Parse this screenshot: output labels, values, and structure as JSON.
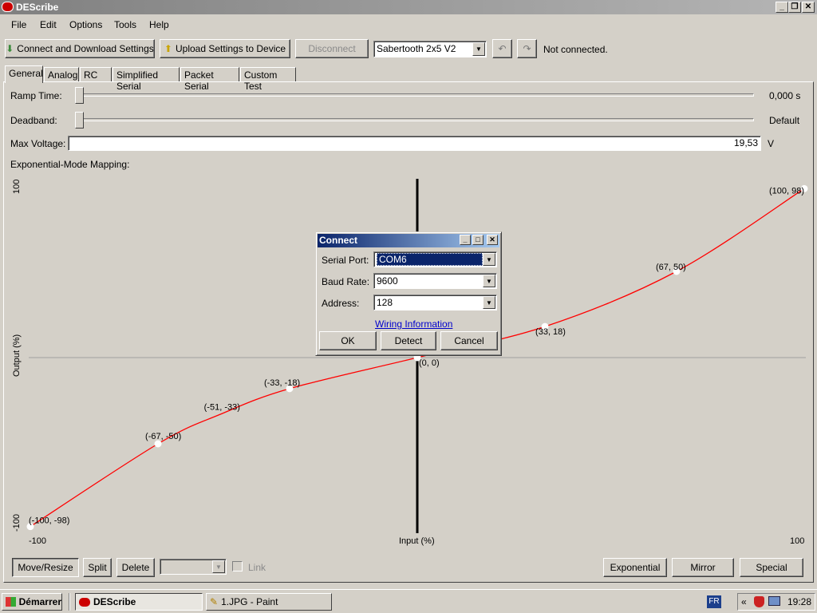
{
  "window": {
    "title": "DEScribe"
  },
  "menu": [
    "File",
    "Edit",
    "Options",
    "Tools",
    "Help"
  ],
  "toolbar": {
    "connect_label": "Connect and Download Settings",
    "upload_label": "Upload Settings to Device",
    "disconnect_label": "Disconnect",
    "device_select": "Sabertooth 2x5 V2",
    "status": "Not connected."
  },
  "tabs": [
    "General",
    "Analog",
    "RC",
    "Simplified Serial",
    "Packet Serial",
    "Custom Test"
  ],
  "active_tab": "General",
  "general": {
    "ramp_label": "Ramp Time:",
    "ramp_value": "0,000 s",
    "ramp_level": 0,
    "deadband_label": "Deadband:",
    "deadband_value": "Default",
    "deadband_level": 0,
    "maxv_label": "Max Voltage:",
    "maxv_value": "19,53",
    "maxv_unit": "V",
    "mapping_label": "Exponential-Mode Mapping:"
  },
  "chart_data": {
    "type": "line",
    "ylabel": "Output (%)",
    "xlabel": "Input (%)",
    "x_tick_min": "-100",
    "x_tick_max": "100",
    "y_tick_min": "-100",
    "y_tick_max": "100",
    "xlim": [
      -100,
      100
    ],
    "ylim": [
      -100,
      100
    ],
    "curve_color": "#ff0000",
    "points": [
      {
        "x": -100,
        "y": -98,
        "label": "(-100, -98)"
      },
      {
        "x": -67,
        "y": -50,
        "label": "(-67, -50)"
      },
      {
        "x": -51,
        "y": -33,
        "label": "(-51, -33)"
      },
      {
        "x": -33,
        "y": -18,
        "label": "(-33, -18)"
      },
      {
        "x": 0,
        "y": 0,
        "label": "(0, 0)"
      },
      {
        "x": 33,
        "y": 18,
        "label": "(33, 18)"
      },
      {
        "x": 67,
        "y": 50,
        "label": "(67, 50)"
      },
      {
        "x": 100,
        "y": 98,
        "label": "(100, 98)"
      }
    ]
  },
  "bottom_buttons": {
    "move_resize": "Move/Resize",
    "split": "Split",
    "delete": "Delete",
    "link": "Link",
    "exponential": "Exponential",
    "mirror": "Mirror",
    "special": "Special"
  },
  "connect_dialog": {
    "title": "Connect",
    "serial_port_label": "Serial Port:",
    "serial_port_value": "COM6",
    "baud_label": "Baud Rate:",
    "baud_value": "9600",
    "address_label": "Address:",
    "address_value": "128",
    "wiring_link": "Wiring Information",
    "ok": "OK",
    "detect": "Detect",
    "cancel": "Cancel"
  },
  "taskbar": {
    "start": "Démarrer",
    "task1": "DEScribe",
    "task2": "1.JPG - Paint",
    "lang": "FR",
    "clock": "19:28"
  }
}
